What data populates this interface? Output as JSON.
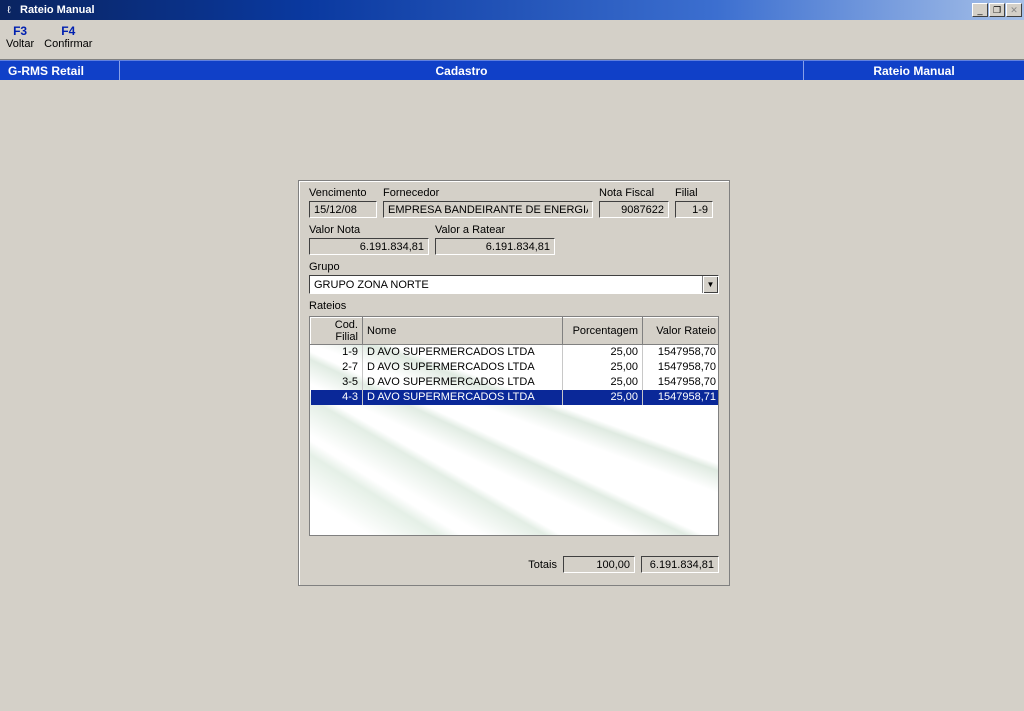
{
  "window": {
    "title": "Rateio Manual"
  },
  "toolbar": {
    "items": [
      {
        "key": "F3",
        "label": "Voltar"
      },
      {
        "key": "F4",
        "label": "Confirmar"
      }
    ]
  },
  "breadcrumb": {
    "left": "G-RMS Retail",
    "mid": "Cadastro",
    "right": "Rateio Manual"
  },
  "labels": {
    "vencimento": "Vencimento",
    "fornecedor": "Fornecedor",
    "nota_fiscal": "Nota Fiscal",
    "filial": "Filial",
    "valor_nota": "Valor Nota",
    "valor_ratear": "Valor a Ratear",
    "grupo": "Grupo",
    "rateios": "Rateios",
    "totais": "Totais"
  },
  "columns": {
    "cod_filial": "Cod. Filial",
    "nome": "Nome",
    "porcentagem": "Porcentagem",
    "valor_rateio": "Valor Rateio"
  },
  "form": {
    "vencimento": "15/12/08",
    "fornecedor": "EMPRESA BANDEIRANTE DE ENERGIA",
    "nota_fiscal": "9087622",
    "filial": "1-9",
    "valor_nota": "6.191.834,81",
    "valor_ratear": "6.191.834,81",
    "grupo": "GRUPO ZONA NORTE"
  },
  "rateios": [
    {
      "cod": "1-9",
      "nome": "D AVO SUPERMERCADOS LTDA",
      "pct": "25,00",
      "val": "1547958,70",
      "selected": false
    },
    {
      "cod": "2-7",
      "nome": "D AVO SUPERMERCADOS LTDA",
      "pct": "25,00",
      "val": "1547958,70",
      "selected": false
    },
    {
      "cod": "3-5",
      "nome": "D AVO SUPERMERCADOS LTDA",
      "pct": "25,00",
      "val": "1547958,70",
      "selected": false
    },
    {
      "cod": "4-3",
      "nome": "D AVO SUPERMERCADOS LTDA",
      "pct": "25,00",
      "val": "1547958,71",
      "selected": true
    }
  ],
  "totals": {
    "pct": "100,00",
    "val": "6.191.834,81"
  }
}
